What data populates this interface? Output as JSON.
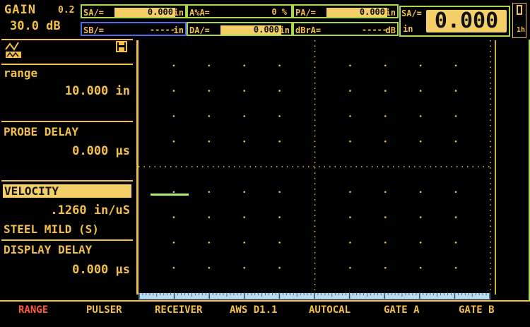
{
  "header": {
    "gain_label": "GAIN",
    "gain_step": "0.2",
    "gain_value": "30.0 dB",
    "readings": [
      {
        "id": "sa",
        "label": "SA/=",
        "value": "0.000",
        "unit": "in"
      },
      {
        "id": "ata",
        "label": "A%A=",
        "value": "0 %",
        "unit": ""
      },
      {
        "id": "pa",
        "label": "PA/=",
        "value": "0.000",
        "unit": "in"
      },
      {
        "id": "sb",
        "label": "SB/=",
        "value": "-----",
        "unit": "in"
      },
      {
        "id": "da",
        "label": "DA/=",
        "value": "0.000",
        "unit": "in"
      },
      {
        "id": "dbra",
        "label": "dBrA=",
        "value": "-----",
        "unit": "dB"
      }
    ],
    "big_reading": {
      "label": "SA/=",
      "value": "0.000",
      "unit": "in"
    },
    "battery_unit": "1h"
  },
  "panel": {
    "range_label": "range",
    "range_value": "10.000 in",
    "probe_delay_label": "PROBE DELAY",
    "probe_delay_value": "0.000 µs",
    "velocity_label": "VELOCITY",
    "velocity_value": ".1260 in/uS",
    "material": "STEEL MILD (S)",
    "display_delay_label": "DISPLAY DELAY",
    "display_delay_value": "0.000 µs"
  },
  "menu": [
    "RANGE",
    "PULSER",
    "RECEIVER",
    "AWS D1.1",
    "AUTOCAL",
    "GATE A",
    "GATE B"
  ],
  "colors": {
    "accent": "#f2c04a",
    "highlight": "#f4cf68",
    "active": "#ff5a3c",
    "gate": "#a8f070",
    "scale": "#b8dcf2"
  }
}
